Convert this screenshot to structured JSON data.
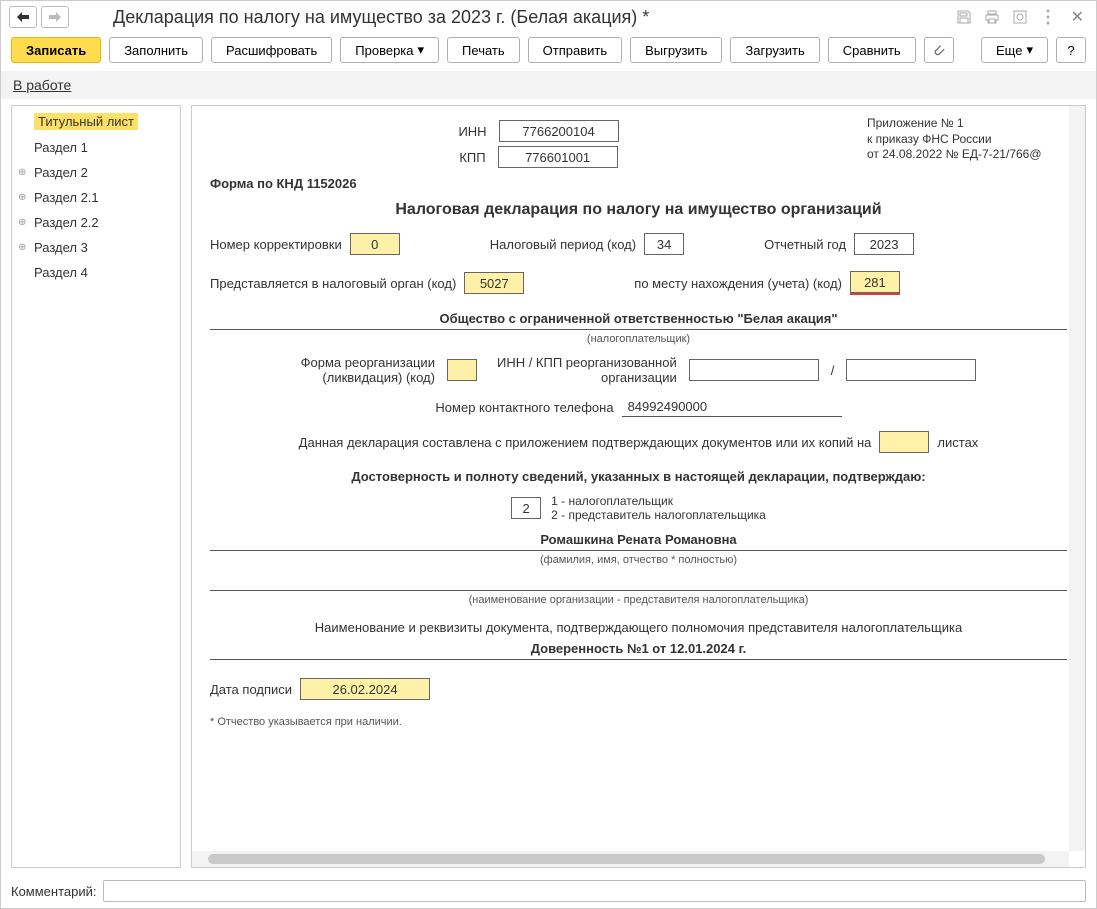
{
  "title": "Декларация по налогу на имущество за 2023 г. (Белая акация) *",
  "toolbar": {
    "write": "Записать",
    "fill": "Заполнить",
    "decode": "Расшифровать",
    "check": "Проверка",
    "print": "Печать",
    "send": "Отправить",
    "upload": "Выгрузить",
    "download": "Загрузить",
    "compare": "Сравнить",
    "more": "Еще",
    "help": "?"
  },
  "status": "В работе",
  "sidebar": {
    "items": [
      {
        "label": "Титульный лист",
        "selected": true,
        "expandable": false
      },
      {
        "label": "Раздел 1",
        "selected": false,
        "expandable": false
      },
      {
        "label": "Раздел 2",
        "selected": false,
        "expandable": true
      },
      {
        "label": "Раздел 2.1",
        "selected": false,
        "expandable": true
      },
      {
        "label": "Раздел 2.2",
        "selected": false,
        "expandable": true
      },
      {
        "label": "Раздел 3",
        "selected": false,
        "expandable": true
      },
      {
        "label": "Раздел 4",
        "selected": false,
        "expandable": false
      }
    ]
  },
  "form": {
    "inn_label": "ИНН",
    "inn": "7766200104",
    "kpp_label": "КПП",
    "kpp": "776601001",
    "form_code": "Форма по КНД 1152026",
    "appendix_l1": "Приложение № 1",
    "appendix_l2": "к приказу ФНС России",
    "appendix_l3": "от 24.08.2022 № ЕД-7-21/766@",
    "form_title": "Налоговая декларация по налогу на имущество организаций",
    "corr_lbl": "Номер корректировки",
    "corr": "0",
    "period_lbl": "Налоговый период (код)",
    "period": "34",
    "year_lbl": "Отчетный год",
    "year": "2023",
    "authority_lbl": "Представляется в налоговый орган (код)",
    "authority": "5027",
    "place_lbl": "по месту нахождения (учета) (код)",
    "place": "281",
    "org_name": "Общество с ограниченной ответственностью \"Белая акация\"",
    "org_sub": "(налогоплательщик)",
    "reorg_lbl1": "Форма реорганизации",
    "reorg_lbl2": "(ликвидация) (код)",
    "reorg_code": "",
    "reorg_inn_lbl1": "ИНН / КПП реорганизованной",
    "reorg_inn_lbl2": "организации",
    "reorg_slash": "/",
    "phone_lbl": "Номер контактного телефона",
    "phone": "84992490000",
    "attach_l1": "Данная декларация составлена с приложением подтверждающих документов или их копий на",
    "attach_l2": "листах",
    "confirm_heading": "Достоверность и полноту сведений, указанных в настоящей декларации, подтверждаю:",
    "signer_code": "2",
    "signer_opt1": "1 - налогоплательщик",
    "signer_opt2": "2 - представитель налогоплательщика",
    "fio": "Ромашкина Рената Романовна",
    "fio_sub": "(фамилия, имя, отчество *  полностью)",
    "rep_org_sub": "(наименование организации - представителя налогоплательщика)",
    "rep_doc_heading": "Наименование и реквизиты документа, подтверждающего полномочия представителя налогоплательщика",
    "power": "Доверенность №1 от 12.01.2024 г.",
    "sign_date_lbl": "Дата подписи",
    "sign_date": "26.02.2024",
    "footnote": "* Отчество указывается при наличии."
  },
  "comment": {
    "label": "Комментарий:",
    "value": ""
  }
}
